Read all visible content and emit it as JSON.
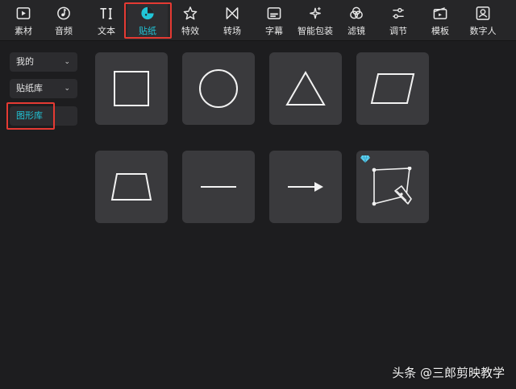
{
  "toolbar": {
    "tabs": [
      {
        "label": "素材",
        "icon": "media-play-icon"
      },
      {
        "label": "音频",
        "icon": "music-note-icon"
      },
      {
        "label": "文本",
        "icon": "text-icon"
      },
      {
        "label": "贴纸",
        "icon": "sticker-icon",
        "active": true
      },
      {
        "label": "特效",
        "icon": "star-effect-icon"
      },
      {
        "label": "转场",
        "icon": "transition-icon"
      },
      {
        "label": "字幕",
        "icon": "subtitle-icon"
      },
      {
        "label": "智能包装",
        "icon": "sparkle-icon"
      },
      {
        "label": "滤镜",
        "icon": "filter-icon"
      },
      {
        "label": "调节",
        "icon": "adjust-sliders-icon"
      },
      {
        "label": "模板",
        "icon": "template-icon"
      },
      {
        "label": "数字人",
        "icon": "digital-human-icon"
      }
    ],
    "accent_color": "#21c6d8"
  },
  "sidebar": {
    "items": [
      {
        "label": "我的",
        "chevron": true
      },
      {
        "label": "贴纸库",
        "chevron": true
      },
      {
        "label": "图形库",
        "active": true
      }
    ]
  },
  "shapes": [
    {
      "name": "square"
    },
    {
      "name": "circle"
    },
    {
      "name": "triangle"
    },
    {
      "name": "parallelogram"
    },
    {
      "name": "trapezoid"
    },
    {
      "name": "line"
    },
    {
      "name": "arrow"
    },
    {
      "name": "pen-tool",
      "premium": true
    }
  ],
  "highlight_color": "#e53a33",
  "watermark": "头条 @三郎剪映教学"
}
